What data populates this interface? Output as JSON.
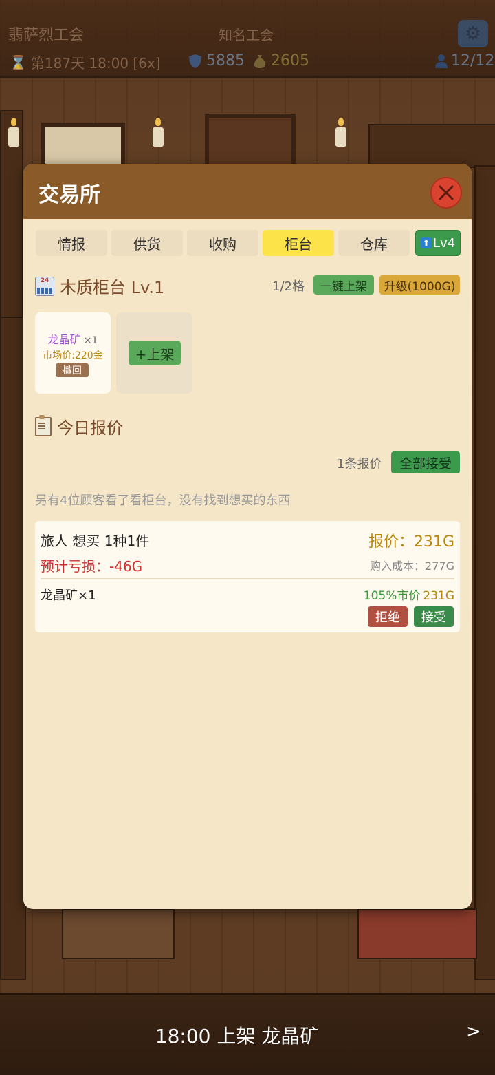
{
  "hud": {
    "guild_name": "翡萨烈工会",
    "guild_rank": "知名工会",
    "day_time": "第187天 18:00 [6x]",
    "defense": "5885",
    "gold": "2605",
    "members": "12/12"
  },
  "modal": {
    "title": "交易所",
    "tabs": [
      {
        "label": "情报"
      },
      {
        "label": "供货"
      },
      {
        "label": "收购"
      },
      {
        "label": "柜台",
        "active": true
      },
      {
        "label": "仓库"
      }
    ],
    "tab_level": "Lv4",
    "counter": {
      "title": "木质柜台 Lv.1",
      "slots": "1/2格",
      "quick_list_label": "一键上架",
      "upgrade_label": "升级(1000G)",
      "listed_item": {
        "name": "龙晶矿",
        "qty": "×1",
        "market_price": "市场价:220金",
        "withdraw_label": "撤回"
      },
      "add_label": "+上架"
    },
    "offers": {
      "title": "今日报价",
      "count": "1条报价",
      "accept_all_label": "全部接受",
      "browse_note": "另有4位顾客看了看柜台，没有找到想买的东西",
      "items": [
        {
          "customer": "旅人 想买 1种1件",
          "price": "报价：231G",
          "loss": "预计亏损：-46G",
          "cost": "购入成本：277G",
          "item": "龙晶矿×1",
          "market_pct": "105%市价",
          "market_val": "231G",
          "reject_label": "拒绝",
          "accept_label": "接受"
        }
      ]
    }
  },
  "log": {
    "text": "18:00 上架 龙晶矿",
    "next": ">"
  },
  "colors": {
    "header": "#8a5a28",
    "panel": "#f5e6c8",
    "active_tab": "#fde34a",
    "accept_green": "#3a8a4a",
    "reject_red": "#b05040",
    "gold_text": "#b8860b",
    "loss_red": "#d03030"
  },
  "icons": [
    "hourglass-icon",
    "shield-icon",
    "money-bag-icon",
    "person-icon",
    "gear-icon",
    "close-icon",
    "upgrade-arrow-icon",
    "counter-icon",
    "clipboard-icon",
    "chevron-right-icon"
  ]
}
